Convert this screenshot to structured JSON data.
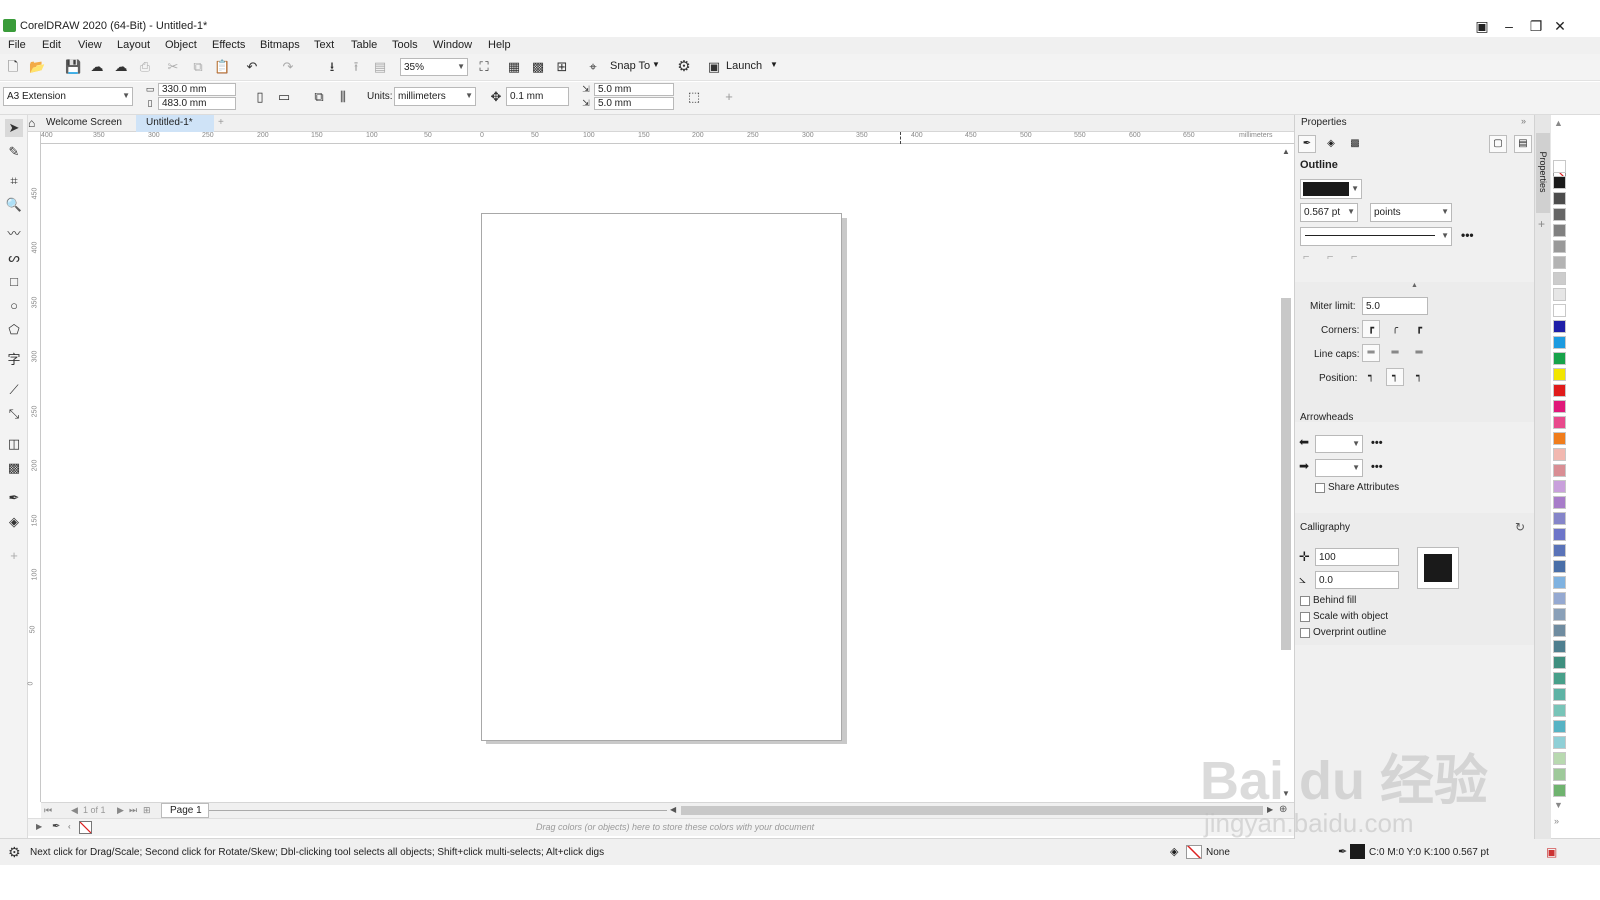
{
  "window": {
    "title": "CorelDRAW 2020 (64-Bit) - Untitled-1*"
  },
  "menu": [
    "File",
    "Edit",
    "View",
    "Layout",
    "Object",
    "Effects",
    "Bitmaps",
    "Text",
    "Table",
    "Tools",
    "Window",
    "Help"
  ],
  "toolbar": {
    "zoom": "35%",
    "snap_to": "Snap To",
    "launch": "Launch"
  },
  "property_bar": {
    "page_size": "A3 Extension",
    "width": "330.0 mm",
    "height": "483.0 mm",
    "units_label": "Units:",
    "units": "millimeters",
    "nudge": "0.1 mm",
    "dup_x": "5.0 mm",
    "dup_y": "5.0 mm"
  },
  "tabs": [
    {
      "label": "Welcome Screen",
      "active": false
    },
    {
      "label": "Untitled-1*",
      "active": true
    }
  ],
  "ruler": {
    "h_ticks": [
      "400",
      "350",
      "300",
      "250",
      "200",
      "150",
      "100",
      "50",
      "0",
      "50",
      "100",
      "150",
      "200",
      "250",
      "300",
      "350",
      "400",
      "450",
      "500",
      "550",
      "600",
      "650"
    ],
    "h_unit": "millimeters",
    "v_ticks": [
      "450",
      "400",
      "350",
      "300",
      "250",
      "200",
      "150",
      "100",
      "50",
      "0"
    ]
  },
  "page_nav": {
    "counter": "1 of 1",
    "page_tab": "Page 1"
  },
  "doc_palette": {
    "hint": "Drag colors (or objects) here to store these colors with your document"
  },
  "status": {
    "message": "Next click for Drag/Scale; Second click for Rotate/Skew; Dbl-clicking tool selects all objects; Shift+click multi-selects; Alt+click digs",
    "fill": "None",
    "outline": "C:0 M:0 Y:0 K:100  0.567 pt"
  },
  "properties": {
    "title": "Properties",
    "outline_header": "Outline",
    "outline_color": "#1a1a1a",
    "width_value": "0.567 pt",
    "width_unit": "points",
    "miter_label": "Miter limit:",
    "miter_value": "5.0",
    "corners_label": "Corners:",
    "line_caps_label": "Line caps:",
    "position_label": "Position:",
    "arrowheads_header": "Arrowheads",
    "share_attributes": "Share Attributes",
    "calligraphy_header": "Calligraphy",
    "stretch_value": "100",
    "angle_value": "0.0",
    "calligraphy_color": "#1a1a1a",
    "behind_fill": "Behind fill",
    "scale_with_object": "Scale with object",
    "overprint_outline": "Overprint outline"
  },
  "side_tab": "Properties",
  "palette_colors": [
    "#ffffff",
    "#1a1a1a",
    "#4d4d4d",
    "#666666",
    "#808080",
    "#999999",
    "#b3b3b3",
    "#cccccc",
    "#e6e6e6",
    "#ffffff",
    "#1f1fa8",
    "#1c9be0",
    "#17a34a",
    "#f2e600",
    "#e01b1b",
    "#e0197a",
    "#e84a8c",
    "#f07d1c",
    "#f2b8b0",
    "#d98e94",
    "#c9a0dc",
    "#a77cc9",
    "#8585c9",
    "#6d75c9",
    "#5a73b8",
    "#4a6fa8",
    "#7fb2e0",
    "#95a9d1",
    "#8aa0b8",
    "#6f8ca0",
    "#4f7f8f",
    "#3f8f7f",
    "#48a08a",
    "#5eb3a5",
    "#78c4b8",
    "#57b3c4",
    "#8fcfd6",
    "#b8d9b0",
    "#9ec99a",
    "#6fb36f"
  ],
  "watermark": {
    "text": "Bai du 经验",
    "url": "jingyan.baidu.com"
  }
}
